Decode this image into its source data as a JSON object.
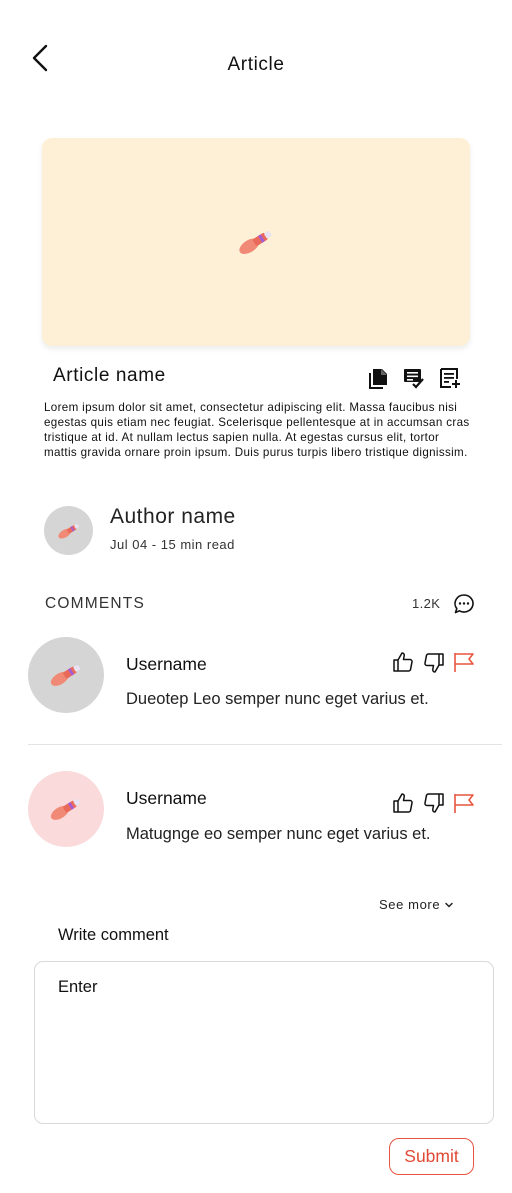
{
  "header": {
    "title": "Article",
    "back_icon": "chevron-left-icon"
  },
  "article": {
    "name": "Article name",
    "body": "Lorem ipsum dolor sit amet, consectetur adipiscing elit. Massa faucibus nisi egestas quis etiam nec feugiat. Scelerisque pellentesque at in accumsan cras tristique at id. At nullam lectus sapien nulla. At egestas cursus elit, tortor mattis gravida ornare proin ipsum. Duis purus turpis libero tristique dignissim.",
    "hero_bg": "#fdf0d7",
    "actions": [
      "copy-icon",
      "checked-document-icon",
      "add-note-icon"
    ]
  },
  "author": {
    "name": "Author name",
    "meta": "Jul 04 - 15 min read"
  },
  "comments_section": {
    "heading": "COMMENTS",
    "count": "1.2K",
    "see_more": "See more",
    "items": [
      {
        "username": "Username",
        "text": "Dueotep Leo semper nunc eget varius et.",
        "avatar_bg": "#d5d5d5"
      },
      {
        "username": "Username",
        "text": "Matugnge eo semper nunc eget varius et.",
        "avatar_bg": "#fadadb"
      }
    ]
  },
  "write_comment": {
    "label": "Write comment",
    "placeholder": "Enter",
    "submit_label": "Submit"
  },
  "colors": {
    "accent": "#e04a35",
    "flag": "#e8553f"
  }
}
